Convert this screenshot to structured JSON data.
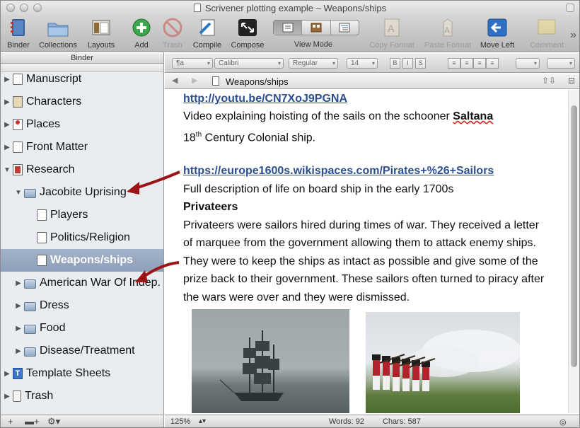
{
  "window": {
    "title": "Scrivener plotting example – Weapons/ships"
  },
  "toolbar": {
    "items": [
      {
        "label": "Binder",
        "icon": "binder-icon",
        "enabled": true
      },
      {
        "label": "Collections",
        "icon": "collections-icon",
        "enabled": true
      },
      {
        "label": "Layouts",
        "icon": "layouts-icon",
        "enabled": true
      },
      {
        "label": "Add",
        "icon": "add-icon",
        "enabled": true
      },
      {
        "label": "Trash",
        "icon": "trash-icon",
        "enabled": false
      },
      {
        "label": "Compile",
        "icon": "compile-icon",
        "enabled": true
      },
      {
        "label": "Compose",
        "icon": "compose-icon",
        "enabled": true
      },
      {
        "label": "View Mode",
        "icon": "view-mode-icon",
        "enabled": true
      },
      {
        "label": "Copy Format",
        "icon": "copy-format-icon",
        "enabled": false
      },
      {
        "label": "Paste Format",
        "icon": "paste-format-icon",
        "enabled": false
      },
      {
        "label": "Move Left",
        "icon": "move-left-icon",
        "enabled": true
      },
      {
        "label": "Comment",
        "icon": "comment-icon",
        "enabled": false
      }
    ]
  },
  "binder": {
    "header": "Binder",
    "items": [
      {
        "label": "Manuscript",
        "icon": "manuscript-icon",
        "expanded": false
      },
      {
        "label": "Characters",
        "icon": "characters-icon",
        "expanded": false
      },
      {
        "label": "Places",
        "icon": "places-icon",
        "expanded": false
      },
      {
        "label": "Front Matter",
        "icon": "front-matter-icon",
        "expanded": false
      },
      {
        "label": "Research",
        "icon": "research-icon",
        "expanded": true
      },
      {
        "label": "Jacobite Uprising",
        "icon": "folder-icon",
        "expanded": true
      },
      {
        "label": "Players",
        "icon": "document-icon"
      },
      {
        "label": "Politics/Religion",
        "icon": "document-icon"
      },
      {
        "label": "Weapons/ships",
        "icon": "document-icon",
        "selected": true
      },
      {
        "label": "American War Of Indep.",
        "icon": "folder-icon",
        "expanded": false
      },
      {
        "label": "Dress",
        "icon": "folder-icon",
        "expanded": false
      },
      {
        "label": "Food",
        "icon": "folder-icon",
        "expanded": false
      },
      {
        "label": "Disease/Treatment",
        "icon": "folder-icon",
        "expanded": false
      },
      {
        "label": "Template Sheets",
        "icon": "template-icon",
        "expanded": false
      },
      {
        "label": "Trash",
        "icon": "trash-icon",
        "expanded": false
      }
    ]
  },
  "format_bar": {
    "style": "¶a",
    "font": "Calibri",
    "weight": "Regular",
    "size": "14",
    "bold": "B",
    "italic": "I",
    "underline": "S"
  },
  "header": {
    "title": "Weapons/ships"
  },
  "document": {
    "link1": "http://youtu.be/CN7XoJ9PGNA",
    "line2_prefix": "Video explaining hoisting of the sails on the schooner ",
    "line2_bold": "Saltana",
    "line3_num": "18",
    "line3_sup": "th",
    "line3_rest": " Century Colonial ship.",
    "link2": "https://europe1600s.wikispaces.com/Pirates+%26+Sailors",
    "line5": "Full description of life on board ship in the early 1700s",
    "heading": "Privateers",
    "body": [
      "Privateers were sailors hired during times of war. They received a letter",
      "of marquee from the government allowing them to attack enemy ships.",
      "They were to keep the ships as intact as possible and give some of the",
      "prize back to their government. These sailors often turned to piracy after",
      "the wars were over and they were dismissed."
    ]
  },
  "status": {
    "zoom": "125%",
    "words": "Words: 92",
    "chars": "Chars: 587"
  }
}
